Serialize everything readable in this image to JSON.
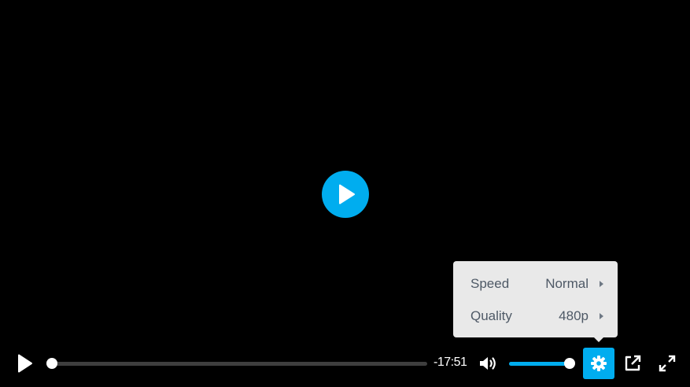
{
  "colors": {
    "accent": "#00adef",
    "menu_bg": "#e9e9e9",
    "menu_text": "#4e5966",
    "track": "#3e3e3e"
  },
  "player": {
    "big_play_icon": "play-icon"
  },
  "settings_menu": {
    "items": [
      {
        "label": "Speed",
        "value": "Normal",
        "icon": "chevron-right-icon"
      },
      {
        "label": "Quality",
        "value": "480p",
        "icon": "chevron-right-icon"
      }
    ]
  },
  "controls": {
    "play_icon": "play-icon",
    "progress_fraction": 0.0,
    "time_remaining": "-17:51",
    "volume_icon": "volume-icon",
    "volume_fraction": 1.0,
    "settings_icon": "gear-icon",
    "popout_icon": "external-link-icon",
    "fullscreen_icon": "fullscreen-icon"
  }
}
